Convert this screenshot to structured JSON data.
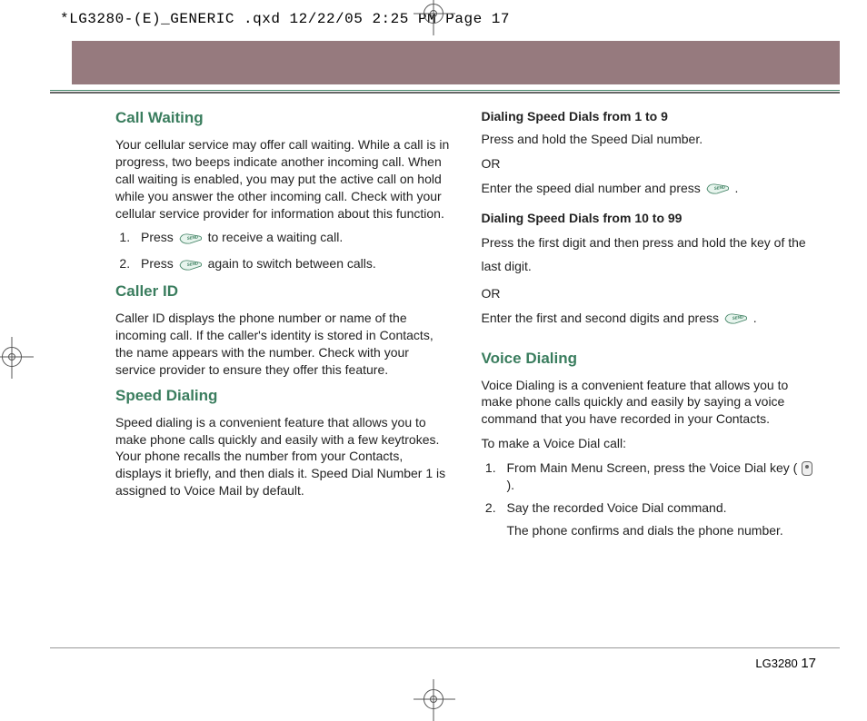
{
  "slugline": "*LG3280-(E)_GENERIC .qxd  12/22/05  2:25 PM  Page 17",
  "footer": {
    "model": "LG3280",
    "page": "17"
  },
  "left": {
    "callWaiting": {
      "title": "Call Waiting",
      "body": "Your cellular service may offer call waiting. While a call is in progress, two beeps indicate another incoming call. When call waiting is enabled, you may put the active call on hold while you answer the other incoming call. Check with your cellular service provider for information about this function.",
      "step1a": "Press ",
      "step1b": " to receive a waiting call.",
      "step2a": "Press ",
      "step2b": " again to switch between calls."
    },
    "callerId": {
      "title": "Caller ID",
      "body": "Caller ID displays the phone number or name of the incoming call. If the caller's identity is stored in Contacts, the name appears with the number. Check with your service provider to ensure they offer this feature."
    },
    "speedDial": {
      "title": "Speed Dialing",
      "body": "Speed dialing is a convenient feature that allows you to make phone calls quickly and easily with a few keytrokes. Your phone recalls the number from your Contacts, displays it briefly, and then dials it. Speed Dial Number 1 is assigned to Voice Mail by default."
    }
  },
  "right": {
    "sd19": {
      "title": "Dialing Speed Dials from 1 to 9",
      "l1": "Press and hold the Speed Dial number.",
      "or": "OR",
      "l2a": "Enter the speed dial number and press ",
      "l2b": "."
    },
    "sd1099": {
      "title": "Dialing Speed Dials from 10 to 99",
      "l1": "Press the first digit and then press and hold the key of the last digit.",
      "or": "OR",
      "l2a": "Enter the first and second digits and press ",
      "l2b": "."
    },
    "voice": {
      "title": "Voice Dialing",
      "body": "Voice Dialing is a convenient feature that allows you to make phone calls quickly and easily by saying a voice command that you have recorded in your Contacts.",
      "lead": "To make a Voice Dial call:",
      "s1a": "From Main Menu Screen, press the Voice Dial key ( ",
      "s1b": " ).",
      "s2": "Say the recorded Voice Dial command.",
      "s2b": "The phone confirms and dials the phone number."
    }
  }
}
